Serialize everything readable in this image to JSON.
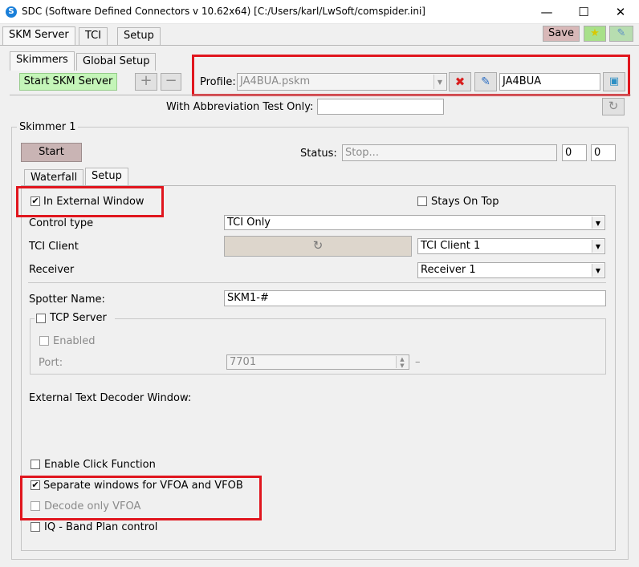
{
  "window": {
    "title": "SDC (Software Defined Connectors v 10.62x64) [C:/Users/karl/LwSoft/comspider.ini]",
    "minimize": "—",
    "maximize": "☐",
    "close": "✕"
  },
  "main_tabs": [
    "SKM Server",
    "TCI",
    "Setup"
  ],
  "toolbar": {
    "save_label": "Save"
  },
  "sub_tabs": [
    "Skimmers",
    "Global Setup"
  ],
  "start_skm_label": "Start SKM Server",
  "add_label": "+",
  "remove_label": "−",
  "profile": {
    "label": "Profile:",
    "value": "JA4BUA.pskm",
    "callsign": "JA4BUA"
  },
  "abbreviation": {
    "label": "With Abbreviation Test Only:",
    "value": ""
  },
  "skimmer": {
    "group_title": "Skimmer 1",
    "start_label": "Start",
    "status_label": "Status:",
    "status_value": "Stop...",
    "status_num1": "0",
    "status_num2": "0",
    "tabs": [
      "Waterfall",
      "Setup"
    ]
  },
  "setup": {
    "in_external_window": {
      "label": "In External Window",
      "checked": true
    },
    "stays_on_top": {
      "label": "Stays On Top",
      "checked": false
    },
    "control_type": {
      "label": "Control type",
      "value": "TCI Only"
    },
    "tci_client": {
      "label": "TCI Client",
      "value": "TCI Client 1"
    },
    "receiver": {
      "label": "Receiver",
      "value": "Receiver 1"
    },
    "spotter_name": {
      "label": "Spotter Name:",
      "value": "SKM1-#"
    },
    "tcp_server": {
      "label": "TCP Server",
      "checked": false
    },
    "enabled": {
      "label": "Enabled",
      "checked": false
    },
    "port": {
      "label": "Port:",
      "value": "7701",
      "suffix": "–"
    },
    "external_text_decoder_label": "External Text Decoder Window:",
    "enable_click": {
      "label": "Enable Click Function",
      "checked": false
    },
    "separate_windows": {
      "label": "Separate windows for VFOA and VFOB",
      "checked": true
    },
    "decode_only_vfoa": {
      "label": "Decode only VFOA",
      "checked": false
    },
    "iq_band_plan": {
      "label": "IQ - Band Plan control",
      "checked": false
    }
  },
  "colors": {
    "start_skm_bg": "#c4f5b8",
    "start_btn_bg": "#c9b4b4",
    "save_bg": "#d8b8b8",
    "highlight": "#e0161e",
    "tci_refresh_bg": "#ddd6cc"
  }
}
